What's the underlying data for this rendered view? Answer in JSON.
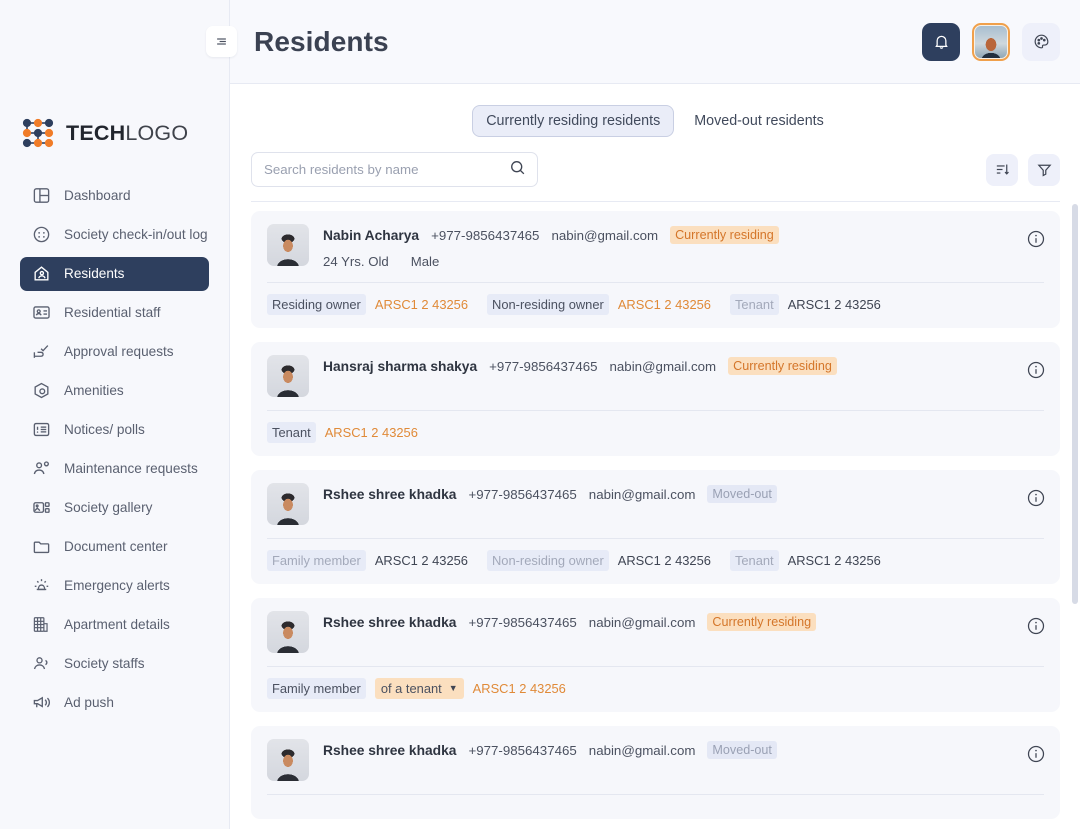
{
  "brand": {
    "name_bold": "TECH",
    "name_light": "LOGO",
    "colors": {
      "navy": "#2e3f5e",
      "orange": "#f07c28",
      "accent_badge_bg": "#fbdfbf",
      "accent_text": "#d4762a"
    }
  },
  "sidebar": {
    "items": [
      {
        "label": "Dashboard",
        "icon": "dashboard-icon",
        "active": false
      },
      {
        "label": "Society check-in/out log",
        "icon": "checkin-log-icon",
        "active": false
      },
      {
        "label": "Residents",
        "icon": "residents-icon",
        "active": true
      },
      {
        "label": "Residential staff",
        "icon": "id-card-icon",
        "active": false
      },
      {
        "label": "Approval requests",
        "icon": "approval-hand-icon",
        "active": false
      },
      {
        "label": "Amenities",
        "icon": "amenities-icon",
        "active": false
      },
      {
        "label": "Notices/ polls",
        "icon": "notices-icon",
        "active": false
      },
      {
        "label": "Maintenance requests",
        "icon": "maintenance-icon",
        "active": false
      },
      {
        "label": "Society gallery",
        "icon": "gallery-icon",
        "active": false
      },
      {
        "label": "Document center",
        "icon": "folder-icon",
        "active": false
      },
      {
        "label": "Emergency alerts",
        "icon": "alert-beacon-icon",
        "active": false
      },
      {
        "label": "Apartment details",
        "icon": "building-icon",
        "active": false
      },
      {
        "label": "Society staffs",
        "icon": "people-icon",
        "active": false
      },
      {
        "label": "Ad push",
        "icon": "megaphone-icon",
        "active": false
      }
    ]
  },
  "topbar": {
    "menu_icon": "hamburger-icon",
    "title": "Residents",
    "bell_icon": "notification-bell-icon",
    "avatar_icon": "user-avatar",
    "theme_icon": "palette-icon"
  },
  "tabs": [
    {
      "label": "Currently residing residents",
      "active": true
    },
    {
      "label": "Moved-out residents",
      "active": false
    }
  ],
  "search": {
    "placeholder": "Search residents by name",
    "value": "",
    "icon": "search-icon"
  },
  "toolbar": {
    "sort_icon": "sort-icon",
    "filter_icon": "filter-icon"
  },
  "residents": [
    {
      "name": "Nabin Acharya",
      "phone": "+977-9856437465",
      "email": "nabin@gmail.com",
      "status": "Currently residing",
      "status_type": "residing",
      "age": "24 Yrs. Old",
      "gender": "Male",
      "units": [
        {
          "role": "Residing owner",
          "role_muted": false,
          "unit": "ARSC1 2 43256",
          "unit_color": "orange"
        },
        {
          "role": "Non-residing owner",
          "role_muted": false,
          "unit": "ARSC1 2 43256",
          "unit_color": "orange"
        },
        {
          "role": "Tenant",
          "role_muted": true,
          "unit": "ARSC1 2 43256",
          "unit_color": "dark"
        }
      ]
    },
    {
      "name": "Hansraj sharma shakya",
      "phone": "+977-9856437465",
      "email": "nabin@gmail.com",
      "status": "Currently residing",
      "status_type": "residing",
      "age": "",
      "gender": "",
      "units": [
        {
          "role": "Tenant",
          "role_muted": false,
          "unit": "ARSC1 2 43256",
          "unit_color": "orange"
        }
      ]
    },
    {
      "name": "Rshee shree khadka",
      "phone": "+977-9856437465",
      "email": "nabin@gmail.com",
      "status": "Moved-out",
      "status_type": "moved",
      "age": "",
      "gender": "",
      "units": [
        {
          "role": "Family member",
          "role_muted": true,
          "unit": "ARSC1 2 43256",
          "unit_color": "dark"
        },
        {
          "role": "Non-residing owner",
          "role_muted": true,
          "unit": "ARSC1 2 43256",
          "unit_color": "dark"
        },
        {
          "role": "Tenant",
          "role_muted": true,
          "unit": "ARSC1 2 43256",
          "unit_color": "dark"
        }
      ]
    },
    {
      "name": "Rshee shree khadka",
      "phone": "+977-9856437465",
      "email": "nabin@gmail.com",
      "status": "Currently residing",
      "status_type": "residing",
      "age": "",
      "gender": "",
      "units": [
        {
          "role": "Family member",
          "role_muted": false,
          "relation": "of a tenant",
          "unit": "ARSC1 2 43256",
          "unit_color": "orange"
        }
      ]
    },
    {
      "name": "Rshee shree khadka",
      "phone": "+977-9856437465",
      "email": "nabin@gmail.com",
      "status": "Moved-out",
      "status_type": "moved",
      "age": "",
      "gender": "",
      "units": []
    }
  ]
}
